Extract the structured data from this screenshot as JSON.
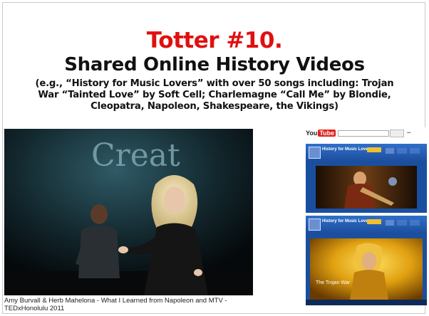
{
  "slide": {
    "title_number": "Totter #10.",
    "title_main": "Shared Online History Videos",
    "subtitle": "(e.g., “History for Music Lovers” with over 50 songs including: Trojan War “Tainted Love” by Soft Cell; Charlemagne “Call Me” by Blondie, Cleopatra, Napoleon, Shakespeare, the Vikings)"
  },
  "photo": {
    "stage_text": "Creat",
    "caption": "Amy Burvall & Herb Mahelona - What I Learned from Napoleon and MTV - TEDxHonolulu 2011"
  },
  "youtube": {
    "logo_you": "You",
    "logo_tube": "Tube",
    "channel_title": "History for Music Lovers",
    "video2_caption": "The Trojan War"
  },
  "colors": {
    "title_red": "#e01010",
    "youtube_blue": "#1a4fa0"
  }
}
